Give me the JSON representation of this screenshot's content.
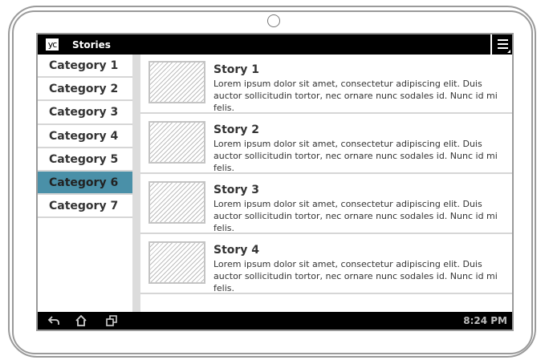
{
  "app": {
    "logo_text": "yc",
    "title": "Stories"
  },
  "sidebar": {
    "items": [
      {
        "label": "Category 1"
      },
      {
        "label": "Category 2"
      },
      {
        "label": "Category 3"
      },
      {
        "label": "Category 4"
      },
      {
        "label": "Category 5"
      },
      {
        "label": "Category 6",
        "selected": true
      },
      {
        "label": "Category 7"
      }
    ]
  },
  "stories": [
    {
      "title": "Story 1",
      "text": "Lorem ipsum dolor sit amet, consectetur adipiscing elit. Duis auctor sollicitudin tortor, nec ornare nunc sodales id. Nunc id mi felis."
    },
    {
      "title": "Story 2",
      "text": "Lorem ipsum dolor sit amet, consectetur adipiscing elit. Duis auctor sollicitudin tortor, nec ornare nunc sodales id. Nunc id mi felis."
    },
    {
      "title": "Story 3",
      "text": "Lorem ipsum dolor sit amet, consectetur adipiscing elit. Duis auctor sollicitudin tortor, nec ornare nunc sodales id. Nunc id mi felis."
    },
    {
      "title": "Story 4",
      "text": "Lorem ipsum dolor sit amet, consectetur adipiscing elit. Duis auctor sollicitudin tortor, nec ornare nunc sodales id. Nunc id mi felis."
    }
  ],
  "status_bar": {
    "time": "8:24 PM",
    "icons": [
      "back-icon",
      "home-icon",
      "recent-apps-icon"
    ]
  },
  "colors": {
    "accent": "#4a90a8",
    "bar": "#000000"
  }
}
